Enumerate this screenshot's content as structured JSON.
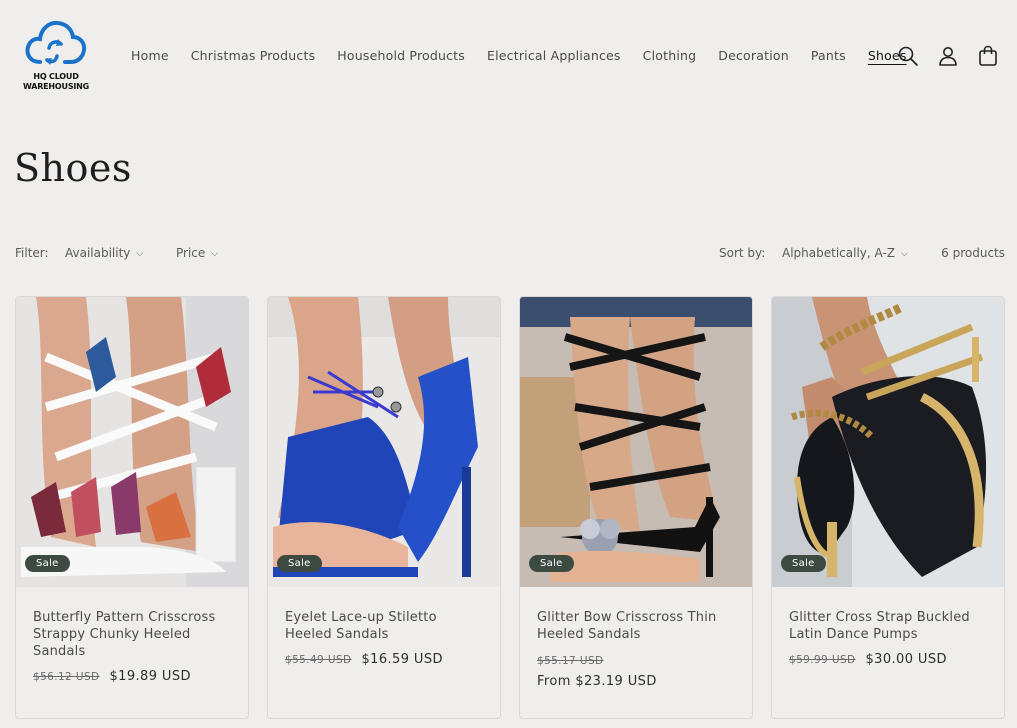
{
  "brand": {
    "logo_text_line1": "HQ CLOUD",
    "logo_text_line2": "WAREHOUSING",
    "accent": "#1a73c8"
  },
  "nav": {
    "items": [
      {
        "label": "Home"
      },
      {
        "label": "Christmas Products"
      },
      {
        "label": "Household Products"
      },
      {
        "label": "Electrical Appliances"
      },
      {
        "label": "Clothing"
      },
      {
        "label": "Decoration"
      },
      {
        "label": "Pants"
      },
      {
        "label": "Shoes",
        "active": true
      }
    ]
  },
  "header_icons": [
    "search-icon",
    "account-icon",
    "cart-icon"
  ],
  "page": {
    "title": "Shoes"
  },
  "filters": {
    "label": "Filter:",
    "availability": "Availability",
    "price": "Price",
    "sort_label": "Sort by:",
    "sort_value": "Alphabetically, A-Z",
    "count": "6 products"
  },
  "products": [
    {
      "name": "Butterfly Pattern Crisscross Strappy Chunky Heeled Sandals",
      "badge": "Sale",
      "old_price": "$56.12 USD",
      "price": "$19.89 USD",
      "from_price": ""
    },
    {
      "name": "Eyelet Lace-up Stiletto Heeled Sandals",
      "badge": "Sale",
      "old_price": "$55.49 USD",
      "price": "$16.59 USD",
      "from_price": ""
    },
    {
      "name": "Glitter Bow Crisscross Thin Heeled Sandals",
      "badge": "Sale",
      "old_price": "$55.17 USD",
      "price": "",
      "from_price": "From $23.19 USD"
    },
    {
      "name": "Glitter Cross Strap Buckled Latin Dance Pumps",
      "badge": "Sale",
      "old_price": "$59.99 USD",
      "price": "$30.00 USD",
      "from_price": ""
    }
  ],
  "colors": {
    "background": "#efeeed",
    "badge": "#3c4a42",
    "text": "#3a3a3a"
  }
}
